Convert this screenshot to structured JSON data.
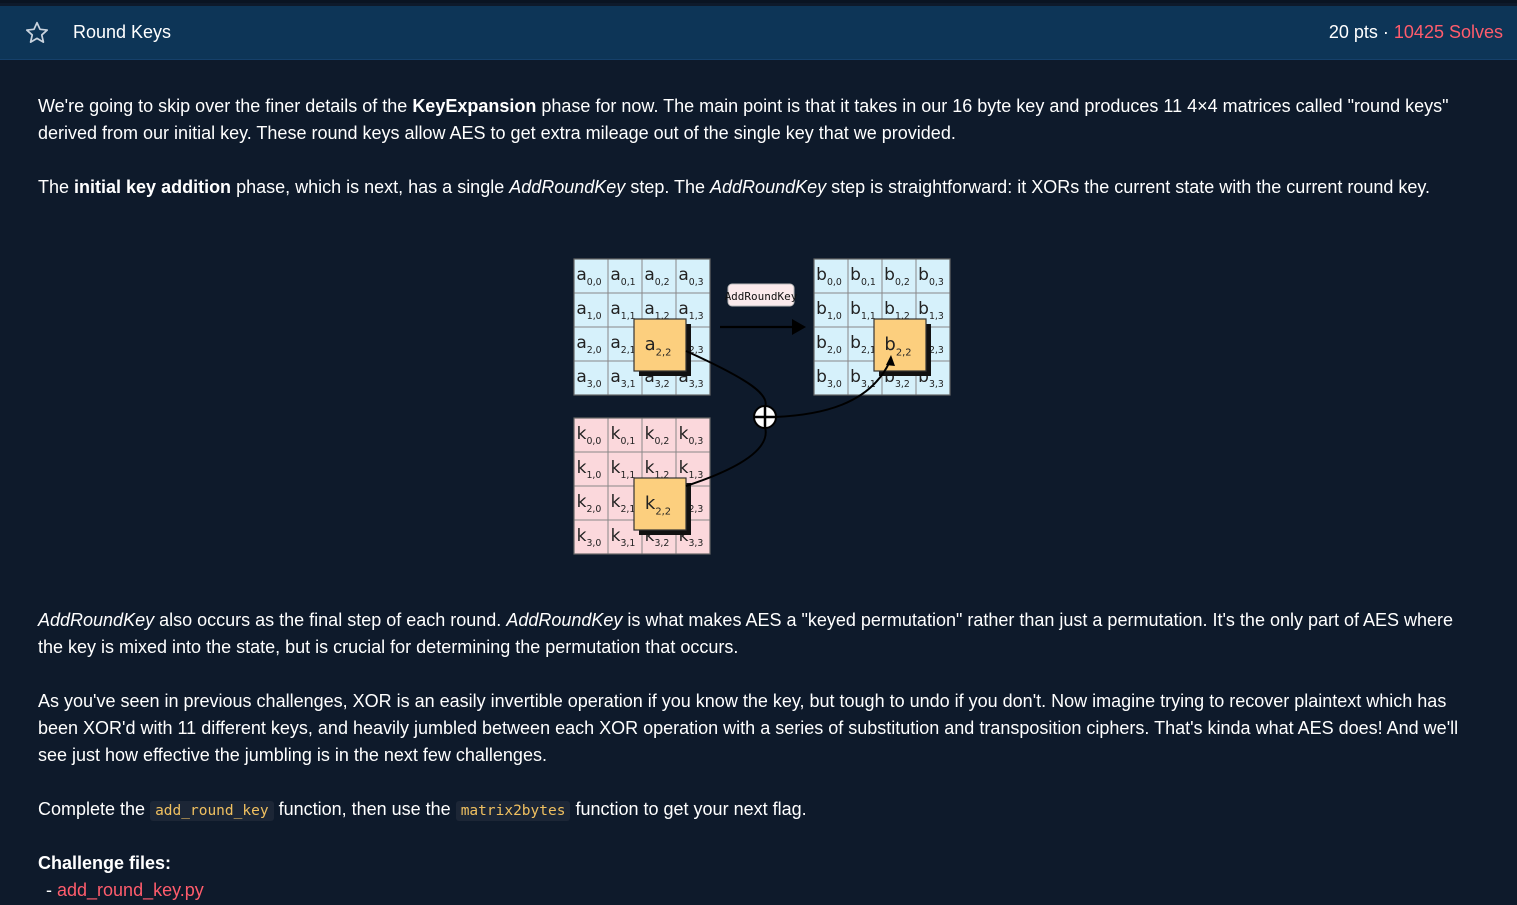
{
  "header": {
    "title": "Round Keys",
    "points": "20 pts",
    "separator": "·",
    "solves": "10425 Solves"
  },
  "colors": {
    "header_bg": "#0d3557",
    "page_bg": "#0e1a2b",
    "accent_red": "#ff5c6c",
    "state_cell": "#d6f1fb",
    "key_cell": "#fbd8dc",
    "highlight_cell": "#fccf7e"
  },
  "intro": {
    "t1": "We're going to skip over the finer details of the ",
    "b1": "KeyExpansion",
    "t2": " phase for now. The main point is that it takes in our 16 byte key and produces 11 4×4 matrices called \"round keys\" derived from our initial key. These round keys allow AES to get extra mileage out of the single key that we provided."
  },
  "addition": {
    "t1": "The ",
    "b1": "initial key addition",
    "t2": " phase, which is next, has a single ",
    "i1": "AddRoundKey",
    "t3": " step. The ",
    "i2": "AddRoundKey",
    "t4": " step is straightforward: it XORs the current state with the current round key."
  },
  "diagram": {
    "label": "AddRoundKey",
    "a": [
      "a0,0",
      "a0,1",
      "a0,2",
      "a0,3",
      "a1,0",
      "a1,1",
      "a1,2",
      "a1,3",
      "a2,0",
      "a2,1",
      "a2,2",
      "a2,3",
      "a3,0",
      "a3,1",
      "a3,2",
      "a3,3"
    ],
    "b": [
      "b0,0",
      "b0,1",
      "b0,2",
      "b0,3",
      "b1,0",
      "b1,1",
      "b1,2",
      "b1,3",
      "b2,0",
      "b2,1",
      "b2,2",
      "b2,3",
      "b3,0",
      "b3,1",
      "b3,2",
      "b3,3"
    ],
    "k": [
      "k0,0",
      "k0,1",
      "k0,2",
      "k0,3",
      "k1,0",
      "k1,1",
      "k1,2",
      "k1,3",
      "k2,0",
      "k2,1",
      "k2,2",
      "k2,3",
      "k3,0",
      "k3,1",
      "k3,2",
      "k3,3"
    ],
    "highlight": {
      "a": "a2,2",
      "b": "b2,2",
      "k": "k2,2"
    }
  },
  "final_step": {
    "i1": "AddRoundKey",
    "t1": " also occurs as the final step of each round. ",
    "i2": "AddRoundKey",
    "t2": " is what makes AES a \"keyed permutation\" rather than just a permutation. It's the only part of AES where the key is mixed into the state, but is crucial for determining the permutation that occurs."
  },
  "xor_text": "As you've seen in previous challenges, XOR is an easily invertible operation if you know the key, but tough to undo if you don't. Now imagine trying to recover plaintext which has been XOR'd with 11 different keys, and heavily jumbled between each XOR operation with a series of substitution and transposition ciphers. That's kinda what AES does! And we'll see just how effective the jumbling is in the next few challenges.",
  "task": {
    "t1": "Complete the ",
    "code1": "add_round_key",
    "t2": " function, then use the ",
    "code2": "matrix2bytes",
    "t3": " function to get your next flag."
  },
  "files": {
    "heading": "Challenge files:",
    "bullet": "- ",
    "items": [
      "add_round_key.py"
    ]
  }
}
